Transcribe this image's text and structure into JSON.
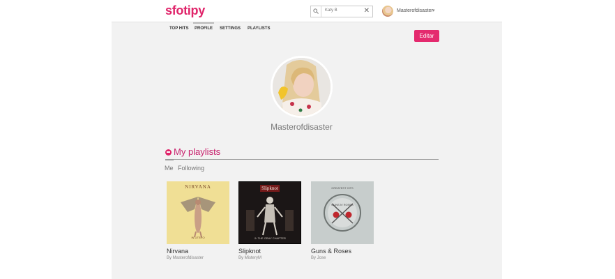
{
  "header": {
    "logo": "sfotipy",
    "search_value": "Katy B",
    "user_name": "Masterofdisaster"
  },
  "tabs": [
    {
      "label": "TOP HITS"
    },
    {
      "label": "PROFILE"
    },
    {
      "label": "SETTINGS"
    },
    {
      "label": "PLAYLISTS"
    }
  ],
  "edit_label": "Editar",
  "profile": {
    "name": "Masterofdisaster"
  },
  "playlists": {
    "title": "My playlists",
    "sub_tabs": [
      "Me",
      "Following"
    ],
    "items": [
      {
        "title": "Nirvana",
        "by": "By Masterofdisaster",
        "cover_text": [
          "NIRVANA",
          "IN UTERO"
        ]
      },
      {
        "title": "Slipknot",
        "by": "By MisteryM",
        "cover_text": [
          "Slipknot",
          ".5: THE GRAY CHAPTER"
        ]
      },
      {
        "title": "Guns & Roses",
        "by": "By Jose",
        "cover_text": [
          "GREATEST HITS",
          "GUNS N' ROSES"
        ]
      }
    ]
  },
  "colors": {
    "accent": "#e0246a",
    "background": "#f2f2f2"
  },
  "icons": [
    "search-icon",
    "clear-icon",
    "chevron-down-icon",
    "playlist-icon"
  ]
}
